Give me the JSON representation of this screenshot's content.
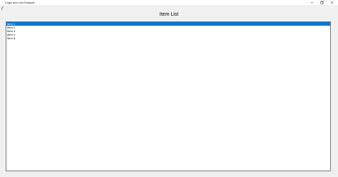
{
  "window": {
    "title": "Login and List Example",
    "controls": {
      "minimize_icon": "minimize-icon",
      "maximize_icon": "maximize-icon",
      "close_icon": "close-icon"
    }
  },
  "main": {
    "heading": "Item List",
    "items": [
      {
        "label": "Item 1",
        "selected": true
      },
      {
        "label": "Item 2",
        "selected": false
      },
      {
        "label": "Item 3",
        "selected": false
      },
      {
        "label": "Item 4",
        "selected": false
      },
      {
        "label": "Item 5",
        "selected": false
      }
    ]
  },
  "colors": {
    "selection": "#0078d7",
    "window_bg": "#f0f0f0"
  }
}
